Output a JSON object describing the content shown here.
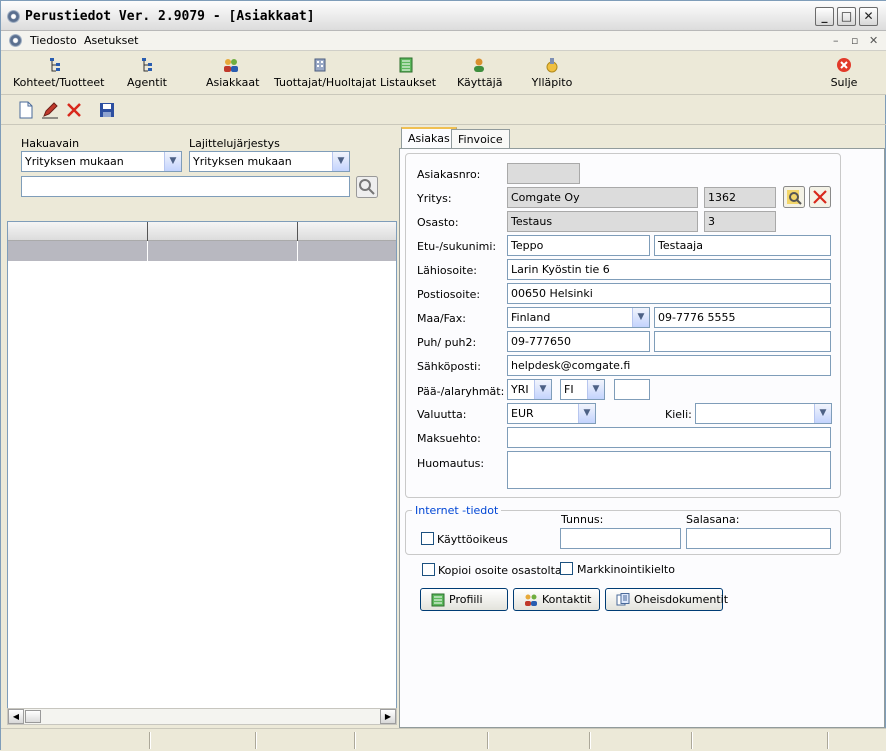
{
  "window": {
    "title": "Perustiedot Ver. 2.9079 - [Asiakkaat]"
  },
  "menu": [
    "Tiedosto",
    "Asetukset"
  ],
  "nav": [
    {
      "label": "Kohteet/Tuotteet",
      "icon": "tree-icon"
    },
    {
      "label": "Agentit",
      "icon": "tree-icon"
    },
    {
      "label": "Asiakkaat",
      "icon": "users-icon"
    },
    {
      "label": "Tuottajat/Huoltajat",
      "icon": "building-icon"
    },
    {
      "label": "Listaukset",
      "icon": "list-icon"
    },
    {
      "label": "Käyttäjä",
      "icon": "user-icon"
    },
    {
      "label": "Ylläpito",
      "icon": "maintenance-icon"
    },
    {
      "label": "Sulje",
      "icon": "close-circle-icon"
    }
  ],
  "search": {
    "hakuavain_label": "Hakuavain",
    "hakuavain_value": "Yrityksen mukaan",
    "sort_label": "Lajittelujärjestys",
    "sort_value": "Yrityksen mukaan",
    "query": ""
  },
  "tabs": [
    "Asiakas",
    "Finvoice"
  ],
  "form": {
    "asiakasnro_label": "Asiakasnro:",
    "asiakasnro": "",
    "yritys_label": "Yritys:",
    "yritys": "Comgate Oy",
    "yritys_id": "1362",
    "osasto_label": "Osasto:",
    "osasto": "Testaus",
    "osasto_id": "3",
    "name_label": "Etu-/sukunimi:",
    "first_name": "Teppo",
    "last_name": "Testaaja",
    "address_label": "Lähiosoite:",
    "address": "Larin Kyöstin tie 6",
    "postal_label": "Postiosoite:",
    "postal": "00650 Helsinki",
    "country_label": "Maa/Fax:",
    "country": "Finland",
    "fax": "09-7776 5555",
    "phone_label": "Puh/ puh2:",
    "phone": "09-777650",
    "phone2": "",
    "email_label": "Sähköposti:",
    "email": "helpdesk@comgate.fi",
    "groups_label": "Pää-/alaryhmät:",
    "group_main": "YRI",
    "group_sub": "FI",
    "group_extra": "",
    "currency_label": "Valuutta:",
    "currency": "EUR",
    "language_label": "Kieli:",
    "language": "",
    "payment_label": "Maksuehto:",
    "payment": "",
    "note_label": "Huomautus:",
    "note": ""
  },
  "internet": {
    "legend": "Internet -tiedot",
    "user_label": "Tunnus:",
    "pass_label": "Salasana:",
    "access_label": "Käyttöoikeus"
  },
  "checks": {
    "copy_address": "Kopioi osoite osastolta",
    "marketing_ban": "Markkinointikielto"
  },
  "buttons": {
    "profile": "Profiili",
    "contacts": "Kontaktit",
    "documents": "Oheisdokumentit"
  }
}
